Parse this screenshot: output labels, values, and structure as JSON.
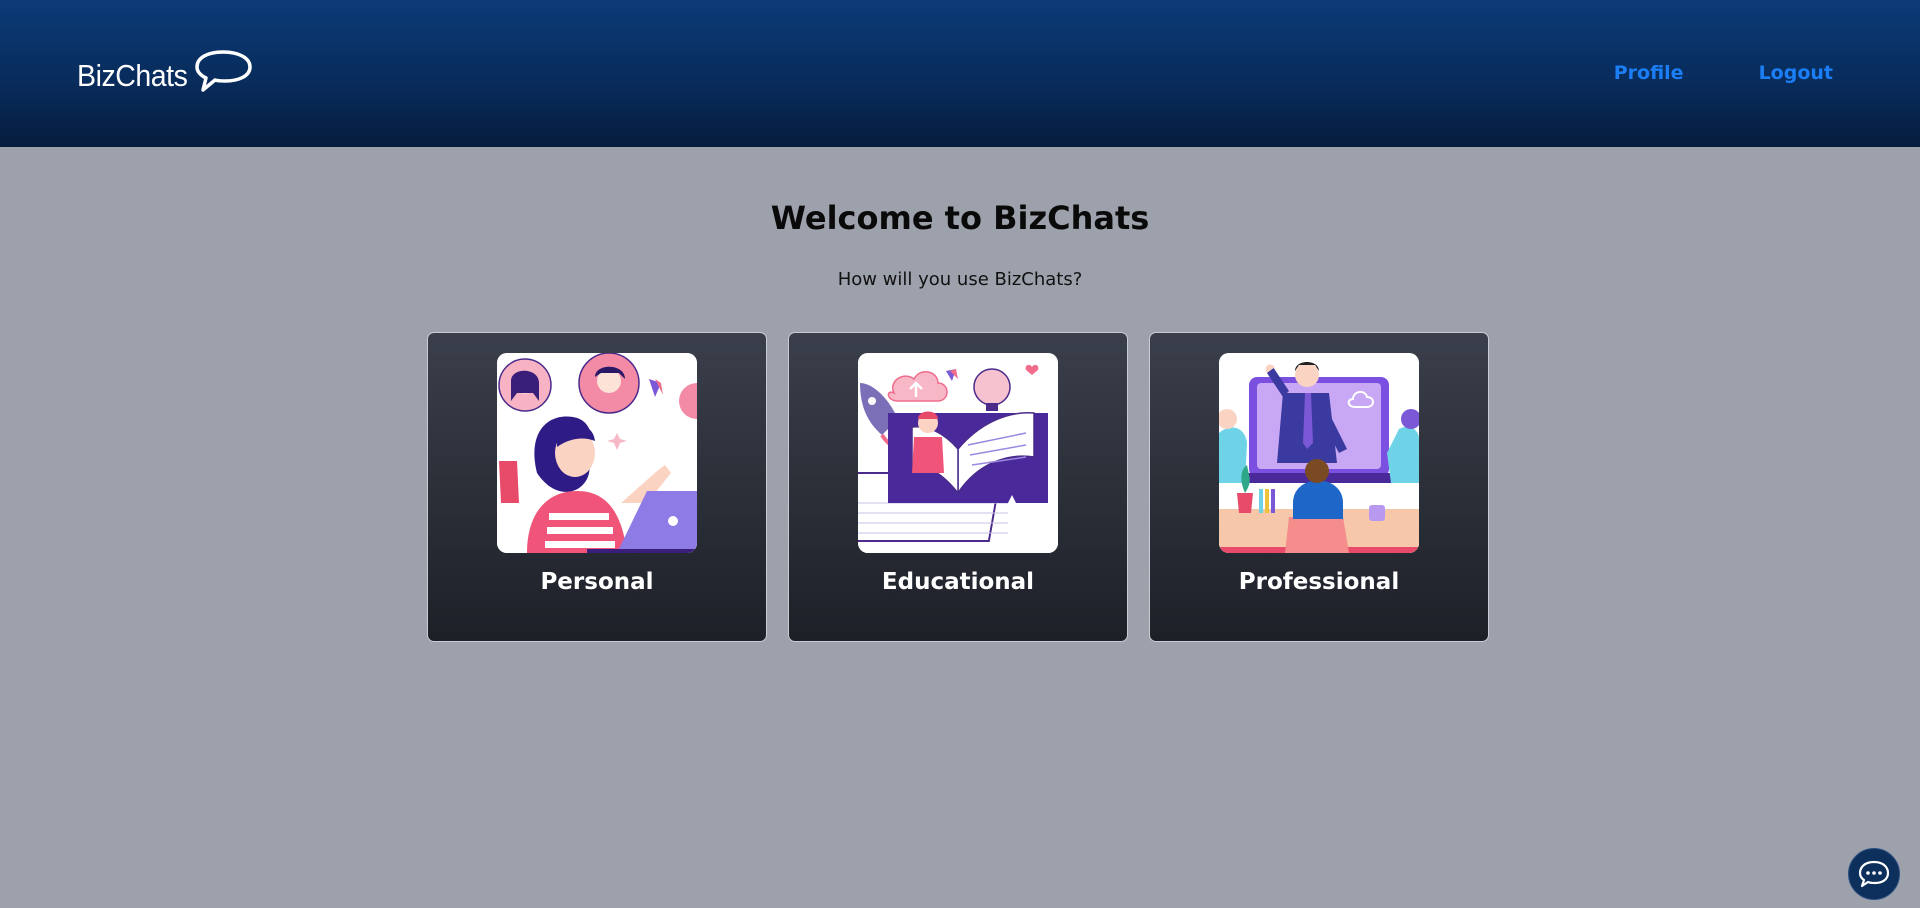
{
  "header": {
    "brand": "BizChats",
    "brand_icon": "speech-bubble-icon",
    "nav": {
      "profile": "Profile",
      "logout": "Logout"
    },
    "link_color": "#1c7ef5"
  },
  "main": {
    "title": "Welcome to BizChats",
    "subtitle": "How will you use BizChats?",
    "cards": [
      {
        "label": "Personal",
        "image": "personal-illustration"
      },
      {
        "label": "Educational",
        "image": "educational-illustration"
      },
      {
        "label": "Professional",
        "image": "professional-illustration"
      }
    ]
  },
  "chat_widget": {
    "icon": "chat-bubble-icon"
  },
  "colors": {
    "header_top": "#0c3b77",
    "header_bottom": "#061c3e",
    "page_bg": "#9da1ab",
    "card_bg": "#2a2e37"
  }
}
